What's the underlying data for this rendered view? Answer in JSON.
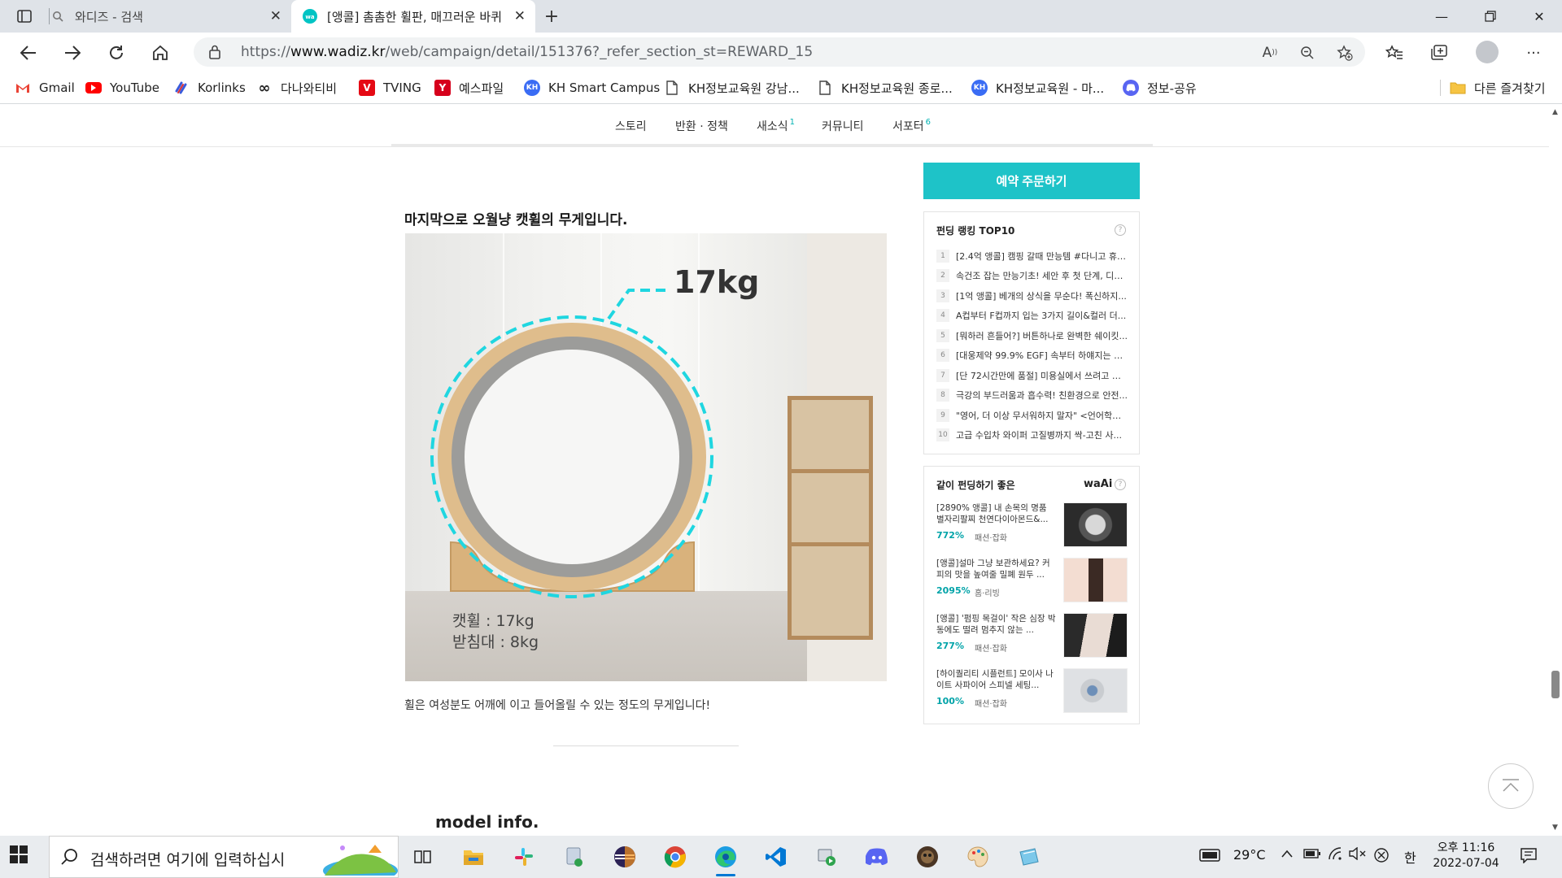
{
  "browser": {
    "tabs": [
      {
        "title": "와디즈 - 검색"
      },
      {
        "title": "[앵콜] 촘촘한 휠판, 매끄러운 바퀴"
      }
    ],
    "url_prefix": "https://",
    "url_domain": "www.wadiz.kr",
    "url_path": "/web/campaign/detail/151376?_refer_section_st=REWARD_15",
    "bookmarks": [
      {
        "label": "Gmail",
        "icon": "gmail-icon",
        "color": "#ea4335"
      },
      {
        "label": "YouTube",
        "icon": "youtube-icon",
        "color": "#ff0000"
      },
      {
        "label": "Korlinks",
        "icon": "korlinks-icon",
        "color": "#3b5bdb"
      },
      {
        "label": "다나와티비",
        "icon": "infinity-icon",
        "color": "#222222"
      },
      {
        "label": "TVING",
        "icon": "tving-icon",
        "color": "#e50914"
      },
      {
        "label": "예스파일",
        "icon": "yesfile-icon",
        "color": "#d6001c"
      },
      {
        "label": "KH Smart Campus",
        "icon": "kh-icon",
        "color": "#3a6cf4"
      },
      {
        "label": "KH정보교육원 강남...",
        "icon": "page-icon",
        "color": "#555555"
      },
      {
        "label": "KH정보교육원 종로...",
        "icon": "page-icon",
        "color": "#555555"
      },
      {
        "label": "KH정보교육원 - 마...",
        "icon": "kh-icon",
        "color": "#3a6cf4"
      },
      {
        "label": "정보-공유",
        "icon": "discord-icon",
        "color": "#5865f2"
      }
    ],
    "other_bookmarks": "다른 즐겨찾기"
  },
  "page": {
    "subnav": [
      {
        "label": "스토리",
        "count": ""
      },
      {
        "label": "반환 · 정책",
        "count": ""
      },
      {
        "label": "새소식",
        "count": "1"
      },
      {
        "label": "커뮤니티",
        "count": ""
      },
      {
        "label": "서포터",
        "count": "6"
      }
    ],
    "story_heading": "마지막으로 오월냥 캣휠의 무게입니다.",
    "photo_weight_callout": "17kg",
    "photo_wheel_weight": "캣휠 : 17kg",
    "photo_stand_weight": "받침대 : 8kg",
    "story_caption": "휠은 여성분도 어깨에 이고 들어올릴 수 있는 정도의 무게입니다!",
    "model_info_heading": "model info.",
    "cta_label": "예약 주문하기",
    "ranking": {
      "title": "펀딩 랭킹 TOP10",
      "items": [
        {
          "rank": "1",
          "title": "[2.4억 앵콜] 캠핑 갈때 만능템 #다니고 휴대..."
        },
        {
          "rank": "2",
          "title": "속건조 잡는 만능기초! 세안 후 첫 단계, 디테..."
        },
        {
          "rank": "3",
          "title": "[1억 앵콜] 베개의 상식을 무순다! 폭신하지..."
        },
        {
          "rank": "4",
          "title": "A컵부터 F컵까지 입는 3가지 길이&컬러 더..."
        },
        {
          "rank": "5",
          "title": "[뭐하러 흔들어?] 버튼하나로 완벽한 쉐이킷..."
        },
        {
          "rank": "6",
          "title": "[대웅제약 99.9% EGF] 속부터 하얘지는 더..."
        },
        {
          "rank": "7",
          "title": "[단 72시간만에 품절] 미용실에서 쓰려고 만..."
        },
        {
          "rank": "8",
          "title": "극강의 부드러움과 흡수력! 친환경으로 안전..."
        },
        {
          "rank": "9",
          "title": "\"영어, 더 이상 무서워하지 말자\" <언어학습..."
        },
        {
          "rank": "10",
          "title": "고급 수입차 와이퍼 고질병까지 싹-고친 사..."
        }
      ]
    },
    "recommend": {
      "title": "같이 펀딩하기 좋은",
      "brand": "waAi",
      "items": [
        {
          "title": "[2890% 앵콜] 내 손목의 명품 별자리팔찌 천연다이아몬드&...",
          "percent": "772%",
          "category": "패션·잡화",
          "thumb": "bracelet"
        },
        {
          "title": "[앵콜]설마 그냥 보관하세요? 커피의 맛을 높여줄 밀폐 원두 ...",
          "percent": "2095%",
          "category": "홈·리빙",
          "thumb": "canister"
        },
        {
          "title": "[앵콜] '펌핑 목걸이' 작은 심장 박동에도 떨려 멈추지 않는 ...",
          "percent": "277%",
          "category": "패션·잡화",
          "thumb": "necklace"
        },
        {
          "title": "[하이퀄리티 시플런트] 모이사 나이트 사파이어 스피넬 세팅...",
          "percent": "100%",
          "category": "패션·잡화",
          "thumb": "rings"
        }
      ]
    }
  },
  "taskbar": {
    "search_placeholder": "검색하려면 여기에 입력하십시",
    "apps": [
      "task-view-icon",
      "file-explorer-icon",
      "slack-icon",
      "app-installer-icon",
      "eclipse-icon",
      "chrome-icon",
      "edge-icon",
      "vscode-icon",
      "media-player-icon",
      "discord-icon",
      "game-icon",
      "paint-icon",
      "notepad-icon"
    ],
    "temperature": "29°C",
    "ime": "한",
    "time_period": "오후 11:16",
    "date": "2022-07-04"
  },
  "colors": {
    "accent": "#1ec3c8",
    "percent": "#00a3a8",
    "dashed_ring": "#1fd6e0"
  }
}
